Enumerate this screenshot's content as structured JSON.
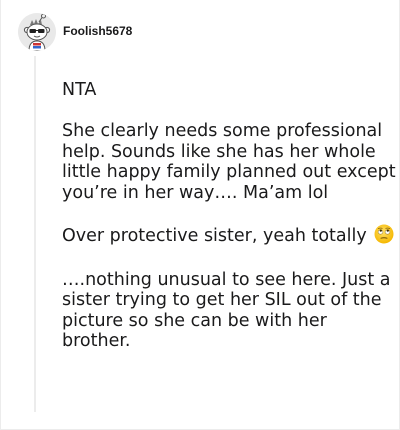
{
  "comment": {
    "username": "Foolish5678",
    "avatar_icon": "snoo-avatar-sunglasses",
    "paragraphs": [
      "NTA",
      "She clearly needs some professional help. Sounds like she has her whole little happy family planned out except you’re in her way…. Ma’am lol",
      "Over protective sister, yeah totally",
      "….nothing unusual to see here. Just a sister trying to get her SIL out of the picture so she can be with her brother."
    ],
    "emoji": "eye-roll-emoji"
  }
}
